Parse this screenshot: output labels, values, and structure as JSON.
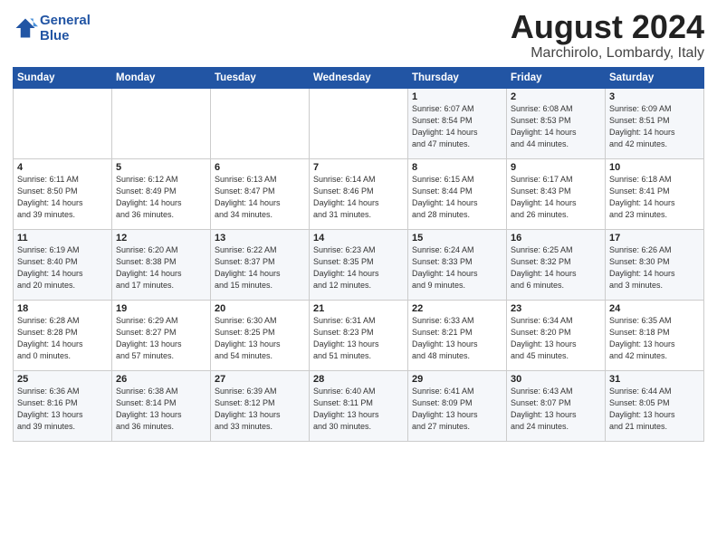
{
  "header": {
    "logo_line1": "General",
    "logo_line2": "Blue",
    "month": "August 2024",
    "location": "Marchirolo, Lombardy, Italy"
  },
  "days_of_week": [
    "Sunday",
    "Monday",
    "Tuesday",
    "Wednesday",
    "Thursday",
    "Friday",
    "Saturday"
  ],
  "weeks": [
    [
      {
        "day": "",
        "info": ""
      },
      {
        "day": "",
        "info": ""
      },
      {
        "day": "",
        "info": ""
      },
      {
        "day": "",
        "info": ""
      },
      {
        "day": "1",
        "info": "Sunrise: 6:07 AM\nSunset: 8:54 PM\nDaylight: 14 hours\nand 47 minutes."
      },
      {
        "day": "2",
        "info": "Sunrise: 6:08 AM\nSunset: 8:53 PM\nDaylight: 14 hours\nand 44 minutes."
      },
      {
        "day": "3",
        "info": "Sunrise: 6:09 AM\nSunset: 8:51 PM\nDaylight: 14 hours\nand 42 minutes."
      }
    ],
    [
      {
        "day": "4",
        "info": "Sunrise: 6:11 AM\nSunset: 8:50 PM\nDaylight: 14 hours\nand 39 minutes."
      },
      {
        "day": "5",
        "info": "Sunrise: 6:12 AM\nSunset: 8:49 PM\nDaylight: 14 hours\nand 36 minutes."
      },
      {
        "day": "6",
        "info": "Sunrise: 6:13 AM\nSunset: 8:47 PM\nDaylight: 14 hours\nand 34 minutes."
      },
      {
        "day": "7",
        "info": "Sunrise: 6:14 AM\nSunset: 8:46 PM\nDaylight: 14 hours\nand 31 minutes."
      },
      {
        "day": "8",
        "info": "Sunrise: 6:15 AM\nSunset: 8:44 PM\nDaylight: 14 hours\nand 28 minutes."
      },
      {
        "day": "9",
        "info": "Sunrise: 6:17 AM\nSunset: 8:43 PM\nDaylight: 14 hours\nand 26 minutes."
      },
      {
        "day": "10",
        "info": "Sunrise: 6:18 AM\nSunset: 8:41 PM\nDaylight: 14 hours\nand 23 minutes."
      }
    ],
    [
      {
        "day": "11",
        "info": "Sunrise: 6:19 AM\nSunset: 8:40 PM\nDaylight: 14 hours\nand 20 minutes."
      },
      {
        "day": "12",
        "info": "Sunrise: 6:20 AM\nSunset: 8:38 PM\nDaylight: 14 hours\nand 17 minutes."
      },
      {
        "day": "13",
        "info": "Sunrise: 6:22 AM\nSunset: 8:37 PM\nDaylight: 14 hours\nand 15 minutes."
      },
      {
        "day": "14",
        "info": "Sunrise: 6:23 AM\nSunset: 8:35 PM\nDaylight: 14 hours\nand 12 minutes."
      },
      {
        "day": "15",
        "info": "Sunrise: 6:24 AM\nSunset: 8:33 PM\nDaylight: 14 hours\nand 9 minutes."
      },
      {
        "day": "16",
        "info": "Sunrise: 6:25 AM\nSunset: 8:32 PM\nDaylight: 14 hours\nand 6 minutes."
      },
      {
        "day": "17",
        "info": "Sunrise: 6:26 AM\nSunset: 8:30 PM\nDaylight: 14 hours\nand 3 minutes."
      }
    ],
    [
      {
        "day": "18",
        "info": "Sunrise: 6:28 AM\nSunset: 8:28 PM\nDaylight: 14 hours\nand 0 minutes."
      },
      {
        "day": "19",
        "info": "Sunrise: 6:29 AM\nSunset: 8:27 PM\nDaylight: 13 hours\nand 57 minutes."
      },
      {
        "day": "20",
        "info": "Sunrise: 6:30 AM\nSunset: 8:25 PM\nDaylight: 13 hours\nand 54 minutes."
      },
      {
        "day": "21",
        "info": "Sunrise: 6:31 AM\nSunset: 8:23 PM\nDaylight: 13 hours\nand 51 minutes."
      },
      {
        "day": "22",
        "info": "Sunrise: 6:33 AM\nSunset: 8:21 PM\nDaylight: 13 hours\nand 48 minutes."
      },
      {
        "day": "23",
        "info": "Sunrise: 6:34 AM\nSunset: 8:20 PM\nDaylight: 13 hours\nand 45 minutes."
      },
      {
        "day": "24",
        "info": "Sunrise: 6:35 AM\nSunset: 8:18 PM\nDaylight: 13 hours\nand 42 minutes."
      }
    ],
    [
      {
        "day": "25",
        "info": "Sunrise: 6:36 AM\nSunset: 8:16 PM\nDaylight: 13 hours\nand 39 minutes."
      },
      {
        "day": "26",
        "info": "Sunrise: 6:38 AM\nSunset: 8:14 PM\nDaylight: 13 hours\nand 36 minutes."
      },
      {
        "day": "27",
        "info": "Sunrise: 6:39 AM\nSunset: 8:12 PM\nDaylight: 13 hours\nand 33 minutes."
      },
      {
        "day": "28",
        "info": "Sunrise: 6:40 AM\nSunset: 8:11 PM\nDaylight: 13 hours\nand 30 minutes."
      },
      {
        "day": "29",
        "info": "Sunrise: 6:41 AM\nSunset: 8:09 PM\nDaylight: 13 hours\nand 27 minutes."
      },
      {
        "day": "30",
        "info": "Sunrise: 6:43 AM\nSunset: 8:07 PM\nDaylight: 13 hours\nand 24 minutes."
      },
      {
        "day": "31",
        "info": "Sunrise: 6:44 AM\nSunset: 8:05 PM\nDaylight: 13 hours\nand 21 minutes."
      }
    ]
  ]
}
